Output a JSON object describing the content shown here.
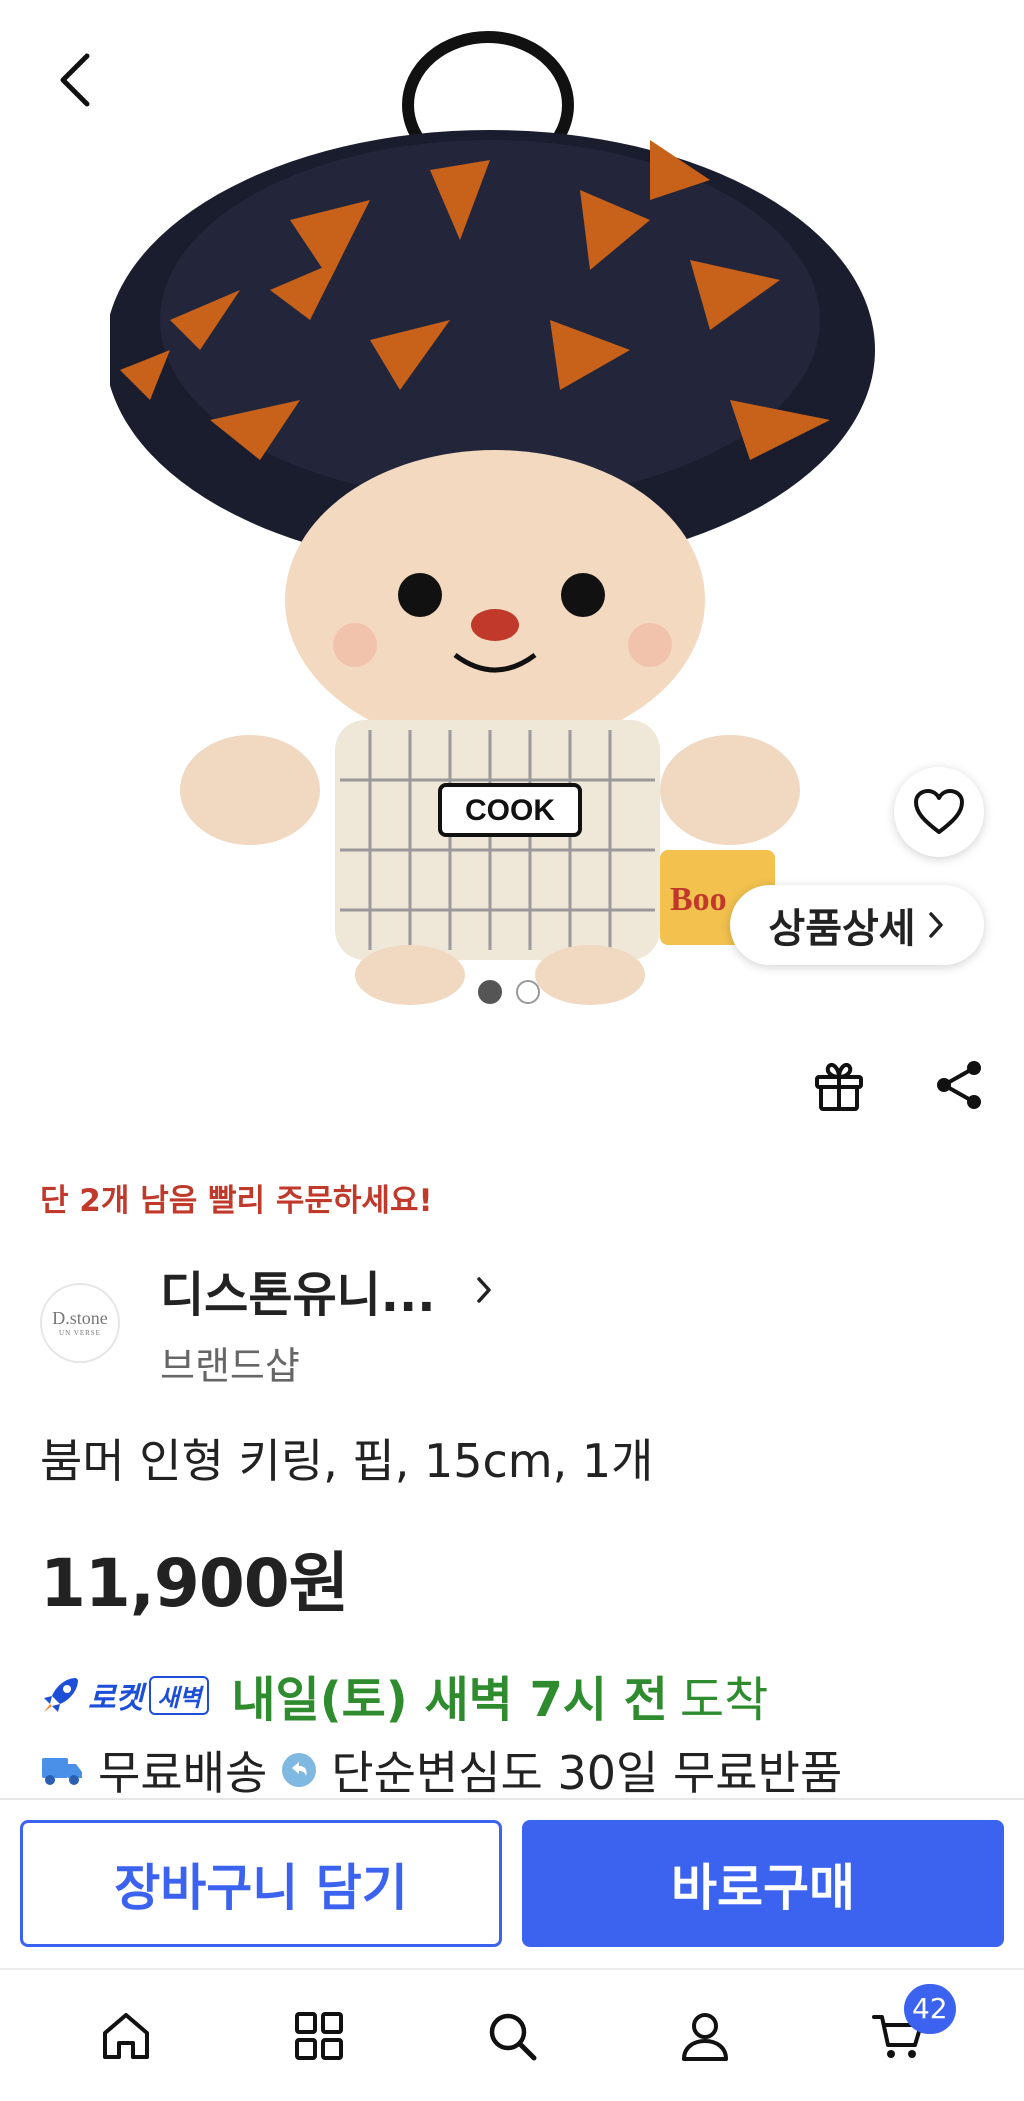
{
  "hero": {
    "product_print_text": "COOK",
    "book_print_text": "Boo",
    "detail_button_label": "상품상세",
    "slide_count": 2,
    "active_slide": 1
  },
  "stock_alert": "단 2개 남음 빨리 주문하세요!",
  "brand": {
    "logo_text": "D.stone",
    "logo_subtext": "UN VERSE",
    "name": "디스톤유니...",
    "subtitle": "브랜드샵"
  },
  "product": {
    "title": "붐머 인형 키링, 핍, 15cm, 1개",
    "price": "11,900원"
  },
  "delivery": {
    "rocket_label": "로켓",
    "dawn_label": "새벽",
    "arrival": "내일(토) 새벽 7시 전",
    "arrival_suffix": "도착"
  },
  "shipping": {
    "free_shipping": "무료배송",
    "return_policy": "단순변심도 30일 무료반품"
  },
  "buttons": {
    "add_to_cart": "장바구니 담기",
    "buy_now": "바로구매"
  },
  "tabs": [
    "home-icon",
    "categories-icon",
    "search-icon",
    "profile-icon",
    "cart-icon"
  ],
  "cart_count": "42",
  "colors": {
    "accent": "#3c63f0",
    "alert": "#c0392b",
    "delivery_green": "#2e8b2e"
  }
}
